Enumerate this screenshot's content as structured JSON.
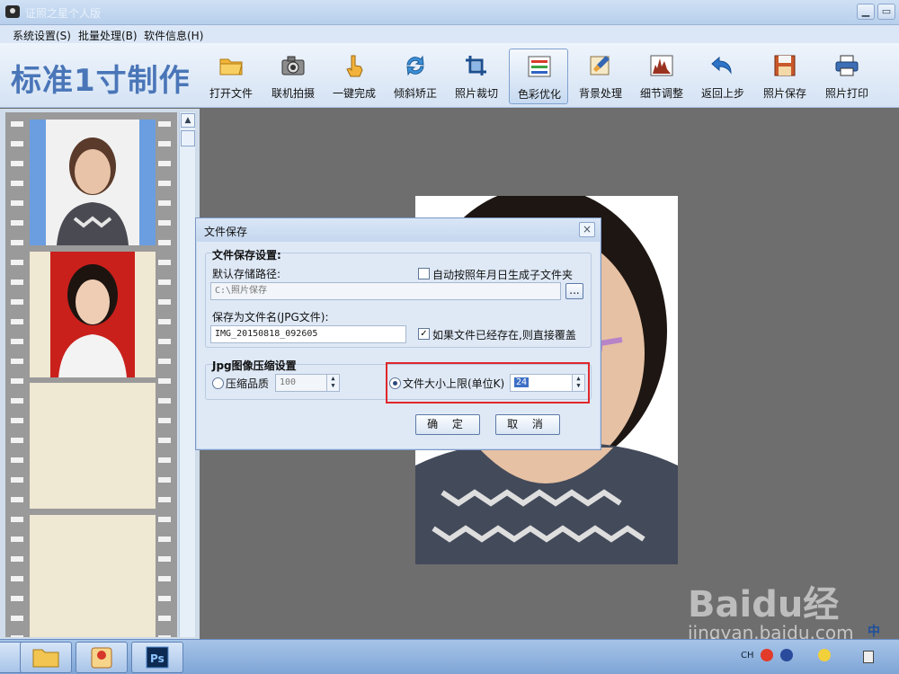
{
  "window": {
    "title": "证照之星个人版"
  },
  "menu": [
    {
      "label": "系统设置(S)"
    },
    {
      "label": "批量处理(B)"
    },
    {
      "label": "软件信息(H)"
    }
  ],
  "toolbar": {
    "logo": "标准1寸制作",
    "tools": [
      {
        "label": "打开文件",
        "icon": "folder-icon"
      },
      {
        "label": "联机拍摄",
        "icon": "camera-icon"
      },
      {
        "label": "一键完成",
        "icon": "hand-pointer-icon"
      },
      {
        "label": "倾斜矫正",
        "icon": "rotate-icon"
      },
      {
        "label": "照片裁切",
        "icon": "crop-icon"
      },
      {
        "label": "色彩优化",
        "icon": "color-bars-icon",
        "active": true
      },
      {
        "label": "背景处理",
        "icon": "brush-icon"
      },
      {
        "label": "细节调整",
        "icon": "histogram-icon"
      },
      {
        "label": "返回上步",
        "icon": "undo-icon"
      },
      {
        "label": "照片保存",
        "icon": "floppy-save-icon"
      },
      {
        "label": "照片打印",
        "icon": "printer-icon"
      }
    ]
  },
  "dialog": {
    "title": "文件保存",
    "close": "×",
    "save_settings_header": "文件保存设置:",
    "default_path_label": "默认存储路径:",
    "auto_subfolder_label": "自动按照年月日生成子文件夹",
    "auto_subfolder_checked": false,
    "path_value": "C:\\照片保存",
    "browse_label": "...",
    "filename_label": "保存为文件名(JPG文件):",
    "filename_value": "IMG_20150818_092605",
    "overwrite_label": "如果文件已经存在,则直接覆盖",
    "overwrite_checked": true,
    "compress_header": "Jpg图像压缩设置",
    "quality_label": "压缩品质",
    "quality_value": "100",
    "size_limit_label": "文件大小上限(单位K)",
    "size_limit_value": "24",
    "ok_label": "确 定",
    "cancel_label": "取 消"
  },
  "taskbar": {
    "tray": {
      "lang": "CH",
      "ime": "中"
    }
  },
  "watermark": {
    "logo": "Baidu经验",
    "url": "jingyan.baidu.com"
  },
  "colors": {
    "accent": "#4a76b8",
    "highlight": "#e0272b",
    "canvas": "#6e6e6e"
  }
}
